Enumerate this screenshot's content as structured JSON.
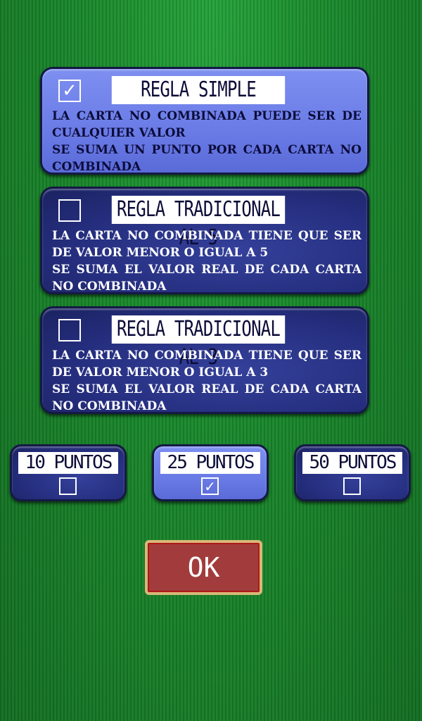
{
  "rules": [
    {
      "title": "REGLA SIMPLE",
      "checked": true,
      "lines": [
        "La carta no combinada puede ser de cualquier valor",
        "Se suma un punto por cada carta no combinada"
      ]
    },
    {
      "title": "REGLA TRADICIONAL AL 5",
      "checked": false,
      "lines": [
        "La carta no combinada tiene que ser de valor menor o igual a 5",
        "Se suma el valor real de cada carta no combinada"
      ]
    },
    {
      "title": "REGLA TRADICIONAL AL 3",
      "checked": false,
      "lines": [
        "La carta no combinada tiene que ser de valor menor o igual a 3",
        "Se suma el valor real de cada carta no combinada"
      ]
    }
  ],
  "points": [
    {
      "label": "10 PUNTOS",
      "checked": false
    },
    {
      "label": "25 PUNTOS",
      "checked": true
    },
    {
      "label": "50 PUNTOS",
      "checked": false
    }
  ],
  "ok_label": "OK",
  "check_glyph": "✓"
}
